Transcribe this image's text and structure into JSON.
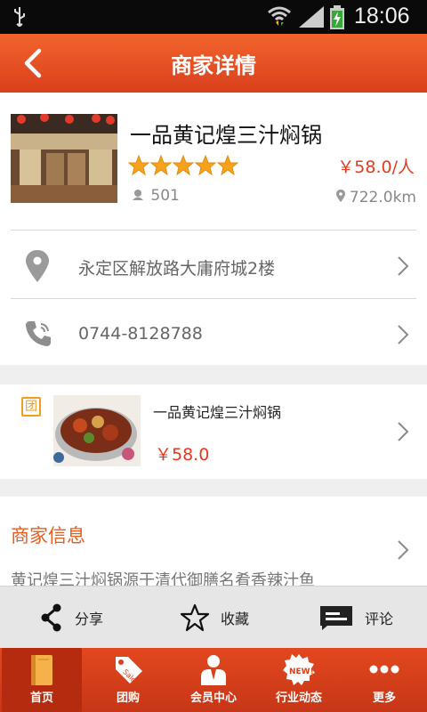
{
  "status": {
    "time": "18:06"
  },
  "header": {
    "title": "商家详情"
  },
  "merchant": {
    "name": "一品黄记煌三汁焖锅",
    "rating_stars": 5,
    "price": "￥58.0/人",
    "views": "501",
    "distance": "722.0km",
    "address": "永定区解放路大庸府城2楼",
    "phone": "0744-8128788"
  },
  "deal": {
    "tag": "团",
    "name": "一品黄记煌三汁焖锅",
    "price": "￥58.0"
  },
  "info": {
    "title": "商家信息",
    "text": "黄记煌三汁焖锅源于清代御膳名肴香辣汁鱼"
  },
  "actions": [
    {
      "label": "分享",
      "icon": "share-icon"
    },
    {
      "label": "收藏",
      "icon": "star-outline-icon"
    },
    {
      "label": "评论",
      "icon": "comment-icon"
    }
  ],
  "nav": [
    {
      "label": "首页",
      "icon": "book-icon"
    },
    {
      "label": "团购",
      "icon": "sale-tag-icon"
    },
    {
      "label": "会员中心",
      "icon": "member-icon"
    },
    {
      "label": "行业动态",
      "icon": "new-badge-icon"
    },
    {
      "label": "更多",
      "icon": "more-dots-icon"
    }
  ],
  "colors": {
    "accent": "#e53a1f",
    "header": "#ea5024",
    "star": "#f7a21b"
  }
}
